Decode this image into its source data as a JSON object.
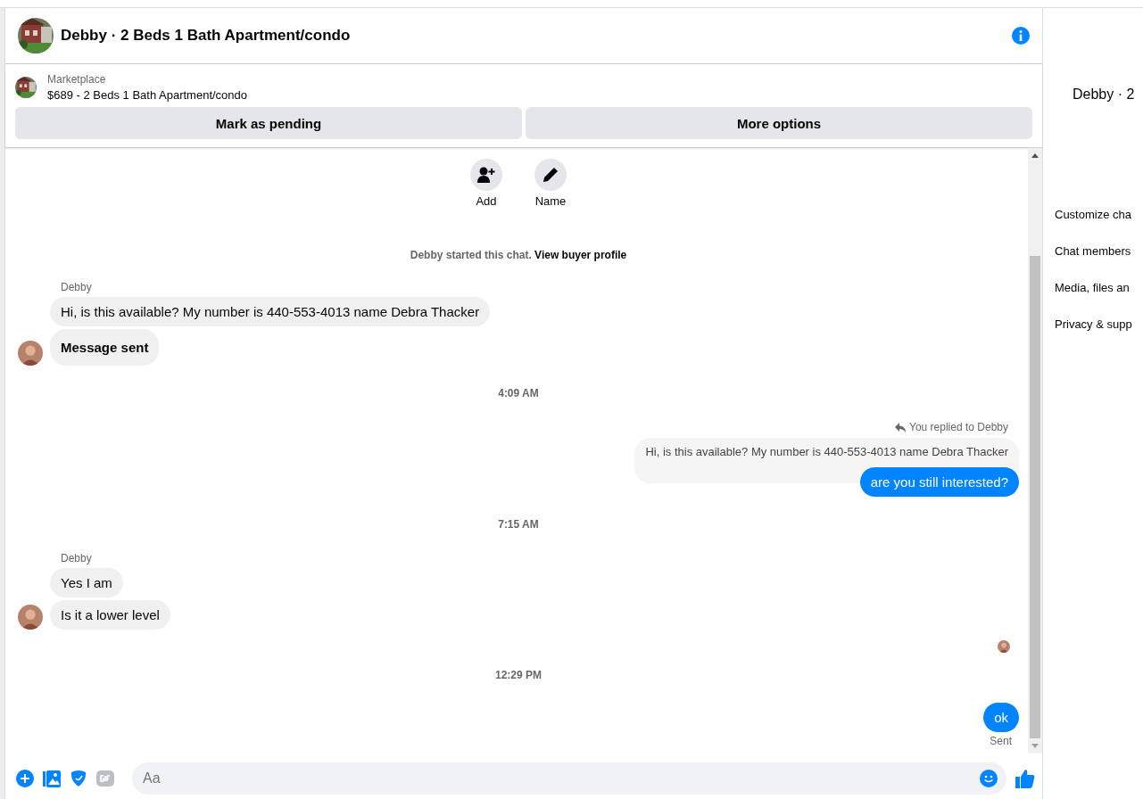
{
  "header": {
    "title": "Debby · 2 Beds 1 Bath Apartment/condo"
  },
  "listing": {
    "source": "Marketplace",
    "title": "$689 - 2 Beds 1 Bath Apartment/condo",
    "actions": [
      "Mark as pending",
      "More options"
    ]
  },
  "chat_actions": [
    {
      "label": "Add",
      "kind": "add"
    },
    {
      "label": "Name",
      "kind": "name"
    }
  ],
  "intro": {
    "text": "Debby started this chat.",
    "link": "View buyer profile"
  },
  "messages": [
    {
      "kind": "incoming",
      "sender": "Debby",
      "bubbles": [
        {
          "kind": "text",
          "text": "Hi, is this available? My number is 440-553-4013 name Debra Thacker"
        },
        {
          "kind": "notice",
          "text": "Message sent"
        }
      ]
    },
    {
      "kind": "time",
      "text": "4:09 AM"
    },
    {
      "kind": "reply",
      "label": "You replied to Debby",
      "quote": "Hi, is this available? My number is 440-553-4013 name Debra Thacker",
      "text": "are you still interested?"
    },
    {
      "kind": "time",
      "text": "7:15 AM"
    },
    {
      "kind": "incoming",
      "sender": "Debby",
      "bubbles": [
        {
          "kind": "text",
          "text": "Yes I am"
        },
        {
          "kind": "text",
          "text": "Is it a lower level"
        }
      ]
    },
    {
      "kind": "seen"
    },
    {
      "kind": "time",
      "text": "12:29 PM"
    },
    {
      "kind": "outgoing",
      "text": "ok",
      "status": "Sent"
    }
  ],
  "composer": {
    "placeholder": "Aa"
  },
  "details": {
    "title": "Debby · 2",
    "items": [
      "Customize cha",
      "Chat members",
      "Media, files an",
      "Privacy & supp"
    ]
  }
}
